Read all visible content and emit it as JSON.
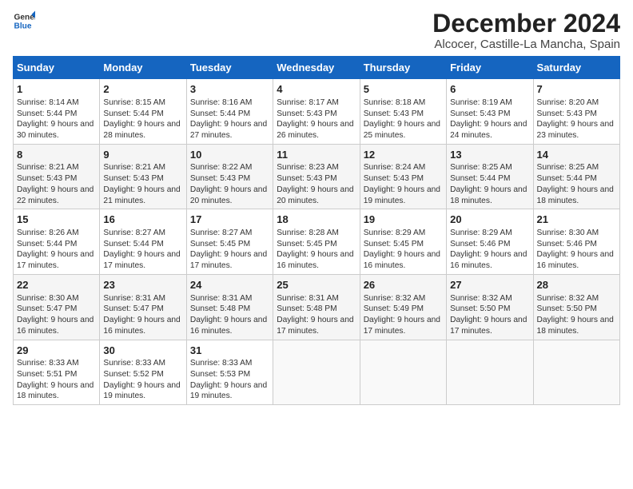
{
  "logo": {
    "general": "General",
    "blue": "Blue"
  },
  "title": "December 2024",
  "subtitle": "Alcocer, Castille-La Mancha, Spain",
  "days_of_week": [
    "Sunday",
    "Monday",
    "Tuesday",
    "Wednesday",
    "Thursday",
    "Friday",
    "Saturday"
  ],
  "weeks": [
    [
      {
        "day": "1",
        "sunrise": "8:14 AM",
        "sunset": "5:44 PM",
        "daylight": "9 hours and 30 minutes."
      },
      {
        "day": "2",
        "sunrise": "8:15 AM",
        "sunset": "5:44 PM",
        "daylight": "9 hours and 28 minutes."
      },
      {
        "day": "3",
        "sunrise": "8:16 AM",
        "sunset": "5:44 PM",
        "daylight": "9 hours and 27 minutes."
      },
      {
        "day": "4",
        "sunrise": "8:17 AM",
        "sunset": "5:43 PM",
        "daylight": "9 hours and 26 minutes."
      },
      {
        "day": "5",
        "sunrise": "8:18 AM",
        "sunset": "5:43 PM",
        "daylight": "9 hours and 25 minutes."
      },
      {
        "day": "6",
        "sunrise": "8:19 AM",
        "sunset": "5:43 PM",
        "daylight": "9 hours and 24 minutes."
      },
      {
        "day": "7",
        "sunrise": "8:20 AM",
        "sunset": "5:43 PM",
        "daylight": "9 hours and 23 minutes."
      }
    ],
    [
      {
        "day": "8",
        "sunrise": "8:21 AM",
        "sunset": "5:43 PM",
        "daylight": "9 hours and 22 minutes."
      },
      {
        "day": "9",
        "sunrise": "8:21 AM",
        "sunset": "5:43 PM",
        "daylight": "9 hours and 21 minutes."
      },
      {
        "day": "10",
        "sunrise": "8:22 AM",
        "sunset": "5:43 PM",
        "daylight": "9 hours and 20 minutes."
      },
      {
        "day": "11",
        "sunrise": "8:23 AM",
        "sunset": "5:43 PM",
        "daylight": "9 hours and 20 minutes."
      },
      {
        "day": "12",
        "sunrise": "8:24 AM",
        "sunset": "5:43 PM",
        "daylight": "9 hours and 19 minutes."
      },
      {
        "day": "13",
        "sunrise": "8:25 AM",
        "sunset": "5:44 PM",
        "daylight": "9 hours and 18 minutes."
      },
      {
        "day": "14",
        "sunrise": "8:25 AM",
        "sunset": "5:44 PM",
        "daylight": "9 hours and 18 minutes."
      }
    ],
    [
      {
        "day": "15",
        "sunrise": "8:26 AM",
        "sunset": "5:44 PM",
        "daylight": "9 hours and 17 minutes."
      },
      {
        "day": "16",
        "sunrise": "8:27 AM",
        "sunset": "5:44 PM",
        "daylight": "9 hours and 17 minutes."
      },
      {
        "day": "17",
        "sunrise": "8:27 AM",
        "sunset": "5:45 PM",
        "daylight": "9 hours and 17 minutes."
      },
      {
        "day": "18",
        "sunrise": "8:28 AM",
        "sunset": "5:45 PM",
        "daylight": "9 hours and 16 minutes."
      },
      {
        "day": "19",
        "sunrise": "8:29 AM",
        "sunset": "5:45 PM",
        "daylight": "9 hours and 16 minutes."
      },
      {
        "day": "20",
        "sunrise": "8:29 AM",
        "sunset": "5:46 PM",
        "daylight": "9 hours and 16 minutes."
      },
      {
        "day": "21",
        "sunrise": "8:30 AM",
        "sunset": "5:46 PM",
        "daylight": "9 hours and 16 minutes."
      }
    ],
    [
      {
        "day": "22",
        "sunrise": "8:30 AM",
        "sunset": "5:47 PM",
        "daylight": "9 hours and 16 minutes."
      },
      {
        "day": "23",
        "sunrise": "8:31 AM",
        "sunset": "5:47 PM",
        "daylight": "9 hours and 16 minutes."
      },
      {
        "day": "24",
        "sunrise": "8:31 AM",
        "sunset": "5:48 PM",
        "daylight": "9 hours and 16 minutes."
      },
      {
        "day": "25",
        "sunrise": "8:31 AM",
        "sunset": "5:48 PM",
        "daylight": "9 hours and 17 minutes."
      },
      {
        "day": "26",
        "sunrise": "8:32 AM",
        "sunset": "5:49 PM",
        "daylight": "9 hours and 17 minutes."
      },
      {
        "day": "27",
        "sunrise": "8:32 AM",
        "sunset": "5:50 PM",
        "daylight": "9 hours and 17 minutes."
      },
      {
        "day": "28",
        "sunrise": "8:32 AM",
        "sunset": "5:50 PM",
        "daylight": "9 hours and 18 minutes."
      }
    ],
    [
      {
        "day": "29",
        "sunrise": "8:33 AM",
        "sunset": "5:51 PM",
        "daylight": "9 hours and 18 minutes."
      },
      {
        "day": "30",
        "sunrise": "8:33 AM",
        "sunset": "5:52 PM",
        "daylight": "9 hours and 19 minutes."
      },
      {
        "day": "31",
        "sunrise": "8:33 AM",
        "sunset": "5:53 PM",
        "daylight": "9 hours and 19 minutes."
      },
      null,
      null,
      null,
      null
    ]
  ]
}
